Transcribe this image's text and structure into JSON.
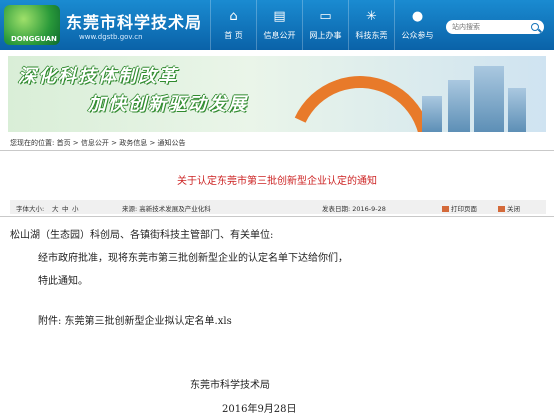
{
  "header": {
    "site_title": "东莞市科学技术局",
    "site_url": "www.dgstb.gov.cn",
    "nav": [
      {
        "label": "首 页",
        "icon": "home-icon",
        "glyph": "⌂"
      },
      {
        "label": "信息公开",
        "icon": "document-icon",
        "glyph": "▤"
      },
      {
        "label": "网上办事",
        "icon": "monitor-icon",
        "glyph": "▭"
      },
      {
        "label": "科技东莞",
        "icon": "atom-icon",
        "glyph": "✳"
      },
      {
        "label": "公众参与",
        "icon": "chat-icon",
        "glyph": "●"
      }
    ],
    "search_placeholder": "站内搜索"
  },
  "banner": {
    "slogan_line1": "深化科技体制改革",
    "slogan_line2": "加快创新驱动发展"
  },
  "breadcrumb": "您现在的位置: 首页 > 信息公开 > 政务信息 > 通知公告",
  "article": {
    "title": "关于认定东莞市第三批创新型企业认定的通知",
    "font_size_label": "字体大小:",
    "font_sizes": [
      "大",
      "中",
      "小"
    ],
    "source_label": "来源: 高新技术发展及产业化科",
    "date_label": "发表日期: 2016-9-28",
    "print_label": "打印页面",
    "close_label": "关闭",
    "salutation": "松山湖（生态园）科创局、各镇街科技主管部门、有关单位:",
    "para1": "经市政府批准，现将东莞市第三批创新型企业的认定名单下达给你们，",
    "para2": "特此通知。",
    "attachment": "附件: 东莞第三批创新型企业拟认定名单.xls",
    "signature": "东莞市科学技术局",
    "sign_date": "2016年9月28日"
  }
}
